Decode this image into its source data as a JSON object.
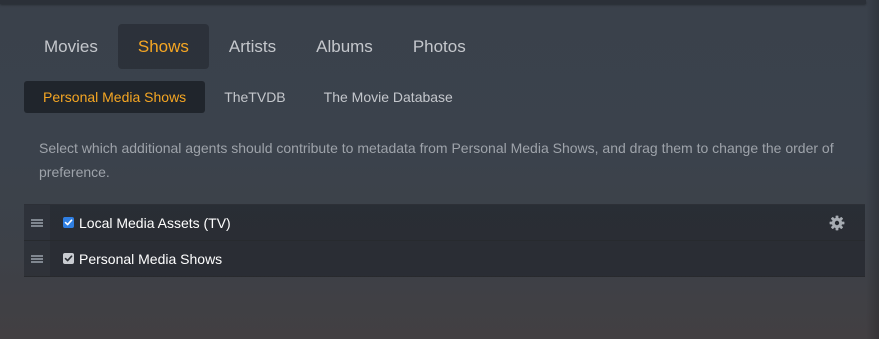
{
  "main_tabs": [
    {
      "label": "Movies",
      "active": false
    },
    {
      "label": "Shows",
      "active": true
    },
    {
      "label": "Artists",
      "active": false
    },
    {
      "label": "Albums",
      "active": false
    },
    {
      "label": "Photos",
      "active": false
    }
  ],
  "sub_tabs": [
    {
      "label": "Personal Media Shows",
      "active": true
    },
    {
      "label": "TheTVDB",
      "active": false
    },
    {
      "label": "The Movie Database",
      "active": false
    }
  ],
  "description": "Select which additional agents should contribute to metadata from Personal Media Shows, and drag them to change the order of preference.",
  "agents": [
    {
      "name": "Local Media Assets (TV)",
      "checked": true,
      "checkbox_style": "blue",
      "has_settings": true,
      "settings_icon": "gear-icon"
    },
    {
      "name": "Personal Media Shows",
      "checked": true,
      "checkbox_style": "gray",
      "has_settings": false
    }
  ],
  "colors": {
    "accent": "#f5a623",
    "checkbox_blue": "#2f7fe3",
    "text": "#c4c7cc"
  }
}
